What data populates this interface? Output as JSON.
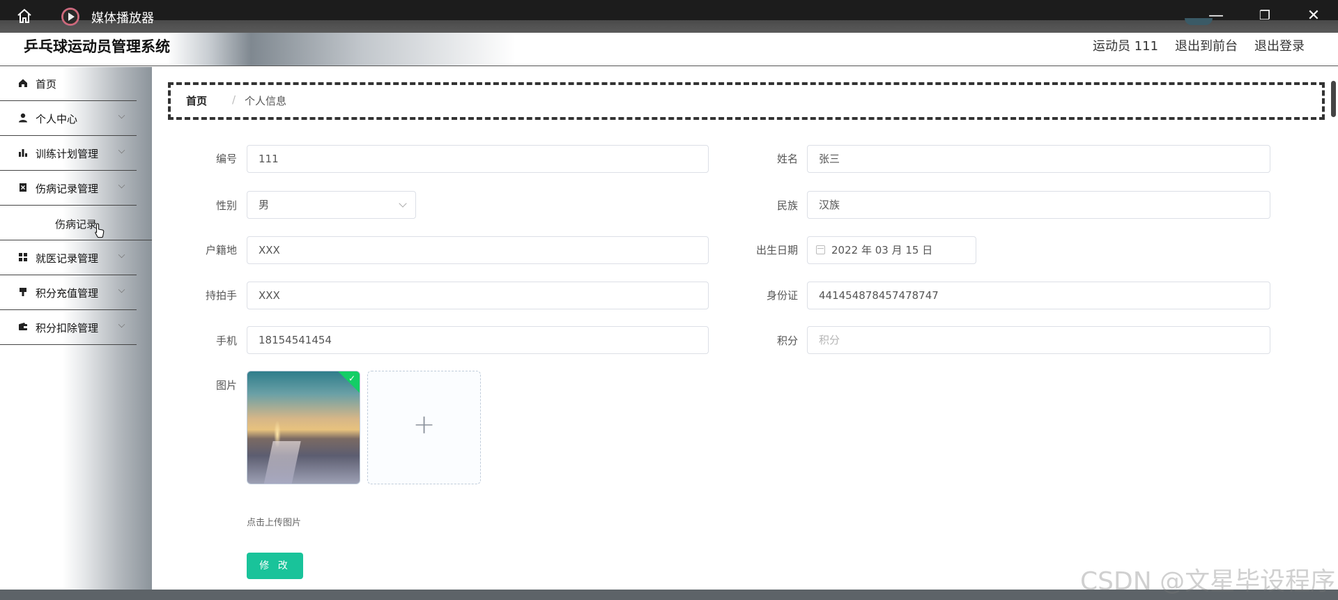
{
  "window": {
    "title": "媒体播放器",
    "minimize_glyph": "—",
    "maximize_glyph": "❐",
    "close_glyph": "✕"
  },
  "header": {
    "app_title": "乒乓球运动员管理系统",
    "user_label": "运动员 111",
    "front_link": "退出到前台",
    "logout_link": "退出登录"
  },
  "sidebar": {
    "items": [
      {
        "label": "首页",
        "icon": "home-icon",
        "has_arrow": false
      },
      {
        "label": "个人中心",
        "icon": "user-icon",
        "has_arrow": true
      },
      {
        "label": "训练计划管理",
        "icon": "bar-chart-icon",
        "has_arrow": true
      },
      {
        "label": "伤病记录管理",
        "icon": "trash-box-icon",
        "has_arrow": true
      },
      {
        "label": "就医记录管理",
        "icon": "grid-icon",
        "has_arrow": true
      },
      {
        "label": "积分充值管理",
        "icon": "brush-icon",
        "has_arrow": true
      },
      {
        "label": "积分扣除管理",
        "icon": "wallet-icon",
        "has_arrow": true
      }
    ],
    "subitem": "伤病记录"
  },
  "breadcrumb": {
    "home": "首页",
    "separator": "/",
    "current": "个人信息"
  },
  "form": {
    "bianhao": {
      "label": "编号",
      "value": "111"
    },
    "xingming": {
      "label": "姓名",
      "value": "张三"
    },
    "xingbie": {
      "label": "性别",
      "value": "男"
    },
    "minzu": {
      "label": "民族",
      "value": "汉族"
    },
    "hujidi": {
      "label": "户籍地",
      "value": "XXX"
    },
    "chusheng": {
      "label": "出生日期",
      "value": "2022 年 03 月 15 日"
    },
    "chipaishou": {
      "label": "持拍手",
      "value": "XXX"
    },
    "shenfenzheng": {
      "label": "身份证",
      "value": "441454878457478747"
    },
    "shouji": {
      "label": "手机",
      "value": "18154541454"
    },
    "jifen": {
      "label": "积分",
      "value": "",
      "placeholder": "积分"
    },
    "tupian": {
      "label": "图片",
      "tip": "点击上传图片"
    },
    "submit": "修 改"
  },
  "watermark": "CSDN @文星毕设程序",
  "colors": {
    "primary": "#19c39a",
    "success": "#13ce66"
  }
}
